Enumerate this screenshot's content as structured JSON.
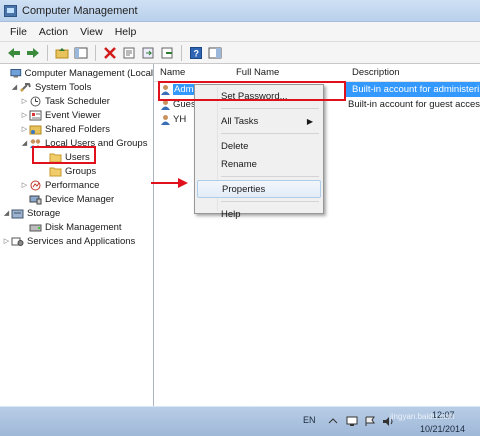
{
  "window": {
    "title": "Computer Management"
  },
  "menubar": {
    "items": [
      "File",
      "Action",
      "View",
      "Help"
    ]
  },
  "tree": {
    "items": [
      {
        "label": "Computer Management (Local",
        "level": 0,
        "expander": "",
        "icon": "computer-management-icon"
      },
      {
        "label": "System Tools",
        "level": 1,
        "expander": "◢",
        "icon": "system-tools-icon"
      },
      {
        "label": "Task Scheduler",
        "level": 2,
        "expander": "▷",
        "icon": "clock-icon"
      },
      {
        "label": "Event Viewer",
        "level": 2,
        "expander": "▷",
        "icon": "event-viewer-icon"
      },
      {
        "label": "Shared Folders",
        "level": 2,
        "expander": "▷",
        "icon": "shared-folder-icon"
      },
      {
        "label": "Local Users and Groups",
        "level": 2,
        "expander": "◢",
        "icon": "users-groups-icon"
      },
      {
        "label": "Users",
        "level": 3,
        "expander": "",
        "icon": "folder-icon"
      },
      {
        "label": "Groups",
        "level": 3,
        "expander": "",
        "icon": "folder-icon"
      },
      {
        "label": "Performance",
        "level": 2,
        "expander": "▷",
        "icon": "performance-icon"
      },
      {
        "label": "Device Manager",
        "level": 2,
        "expander": "",
        "icon": "device-manager-icon"
      },
      {
        "label": "Storage",
        "level": 1,
        "expander": "◢",
        "icon": "storage-icon"
      },
      {
        "label": "Disk Management",
        "level": 2,
        "expander": "",
        "icon": "disk-icon"
      },
      {
        "label": "Services and Applications",
        "level": 1,
        "expander": "▷",
        "icon": "services-icon"
      }
    ]
  },
  "list": {
    "columns": {
      "name": "Name",
      "full_name": "Full Name",
      "description": "Description"
    },
    "rows": [
      {
        "name": "Adm",
        "full_name": "",
        "description": "Built-in account for administeri",
        "selected": true
      },
      {
        "name": "Gues",
        "full_name": "",
        "description": "Built-in account for guest acces",
        "selected": false
      },
      {
        "name": "YH",
        "full_name": "",
        "description": "",
        "selected": false
      }
    ]
  },
  "context_menu": {
    "items": [
      {
        "label": "Set Password...",
        "type": "item"
      },
      {
        "type": "separator"
      },
      {
        "label": "All Tasks",
        "type": "submenu"
      },
      {
        "type": "separator"
      },
      {
        "label": "Delete",
        "type": "item"
      },
      {
        "label": "Rename",
        "type": "item"
      },
      {
        "type": "separator"
      },
      {
        "label": "Properties",
        "type": "item",
        "hover": true
      },
      {
        "type": "separator"
      },
      {
        "label": "Help",
        "type": "item"
      }
    ]
  },
  "taskbar": {
    "language": "EN",
    "time": "12:07",
    "date": "10/21/2014"
  },
  "watermark": {
    "brand": "Baidu",
    "url": "jingyan.baidu.com"
  },
  "colors": {
    "selection": "#3399ff",
    "annotation_red": "#e0101c",
    "tree_bg": "#ffffff"
  }
}
